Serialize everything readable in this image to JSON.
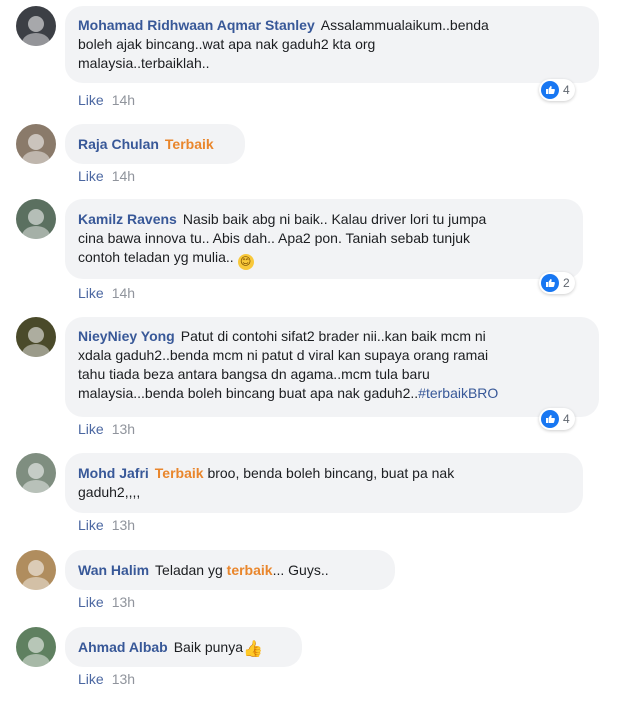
{
  "comments": [
    {
      "author": "Mohamad Ridhwaan Aqmar Stanley",
      "text_parts": [
        "Assalammualaikum..benda",
        "boleh ajak bincang..wat apa nak gaduh2 kta org",
        "malaysia..terbaiklah.."
      ],
      "like_label": "Like",
      "time": "14h",
      "reaction_count": "4",
      "avatar_color": "#3c3f45"
    },
    {
      "author": "Raja Chulan",
      "tag": "Terbaik",
      "like_label": "Like",
      "time": "14h",
      "avatar_color": "#8a7a6a"
    },
    {
      "author": "Kamilz Ravens",
      "text_parts": [
        "Nasib baik abg ni baik.. Kalau driver lori tu jumpa",
        "cina bawa innova tu.. Abis dah.. Apa2 pon. Taniah sebab tunjuk",
        "contoh teladan yg mulia.."
      ],
      "emoji": "😊",
      "like_label": "Like",
      "time": "14h",
      "reaction_count": "2",
      "avatar_color": "#5b7060"
    },
    {
      "author": "NieyNiey Yong",
      "text_parts": [
        "Patut di contohi sifat2 brader nii..kan baik mcm ni",
        "xdala gaduh2..benda mcm ni patut d viral kan supaya orang ramai",
        "tahu tiada beza antara bangsa dn agama..mcm tula baru",
        "malaysia...benda boleh bincang buat apa nak gaduh2.."
      ],
      "hashtag": "#terbaikBRO",
      "like_label": "Like",
      "time": "13h",
      "reaction_count": "4",
      "avatar_color": "#4a4a2a"
    },
    {
      "author": "Mohd Jafri",
      "tag": "Terbaik",
      "text_parts": [
        "broo, benda boleh bincang, buat pa nak",
        "gaduh2,,,,"
      ],
      "like_label": "Like",
      "time": "13h",
      "avatar_color": "#7f8e80"
    },
    {
      "author": "Wan Halim",
      "text_before": "Teladan yg",
      "tag": "terbaik",
      "text_after": "... Guys..",
      "like_label": "Like",
      "time": "13h",
      "avatar_color": "#b08d5e"
    },
    {
      "author": "Ahmad Albab",
      "text_before": "Baik punya",
      "emoji": "👍",
      "like_label": "Like",
      "time": "13h",
      "avatar_color": "#5f8060"
    }
  ]
}
